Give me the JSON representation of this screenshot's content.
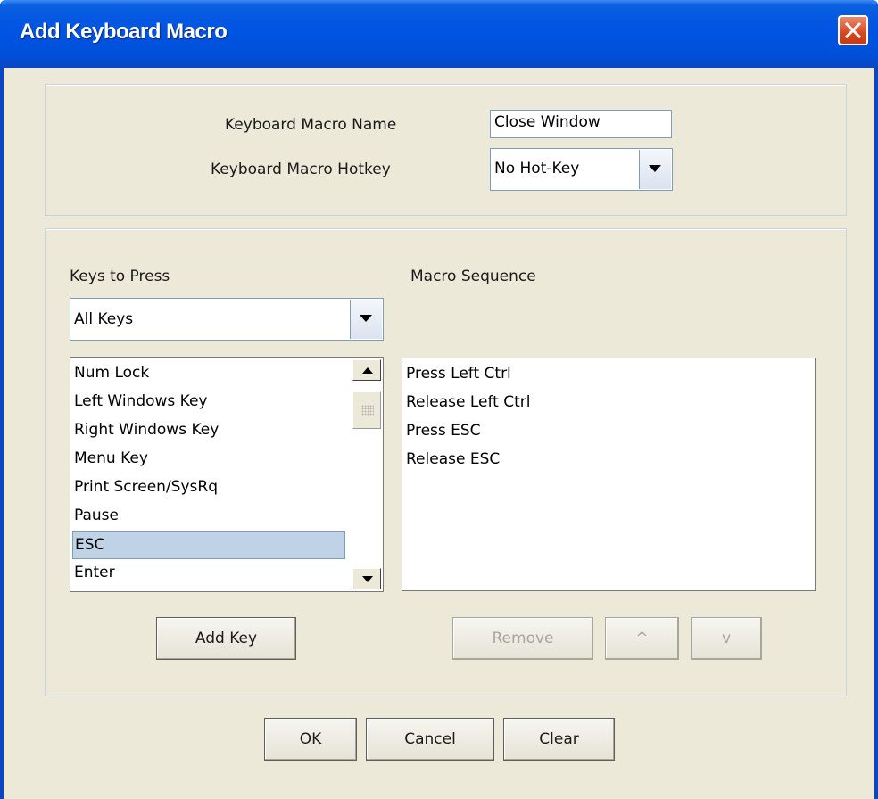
{
  "window": {
    "title": "Add Keyboard Macro",
    "close_glyph": "✕"
  },
  "macro": {
    "name_label": "Keyboard Macro Name",
    "name_value": "Close Window",
    "hotkey_label": "Keyboard Macro Hotkey",
    "hotkey_value": "No Hot-Key"
  },
  "keys": {
    "label": "Keys to Press",
    "filter_value": "All Keys",
    "items": [
      "Num Lock",
      "Left Windows Key",
      "Right Windows Key",
      "Menu Key",
      "Print Screen/SysRq",
      "Pause",
      "ESC",
      "Enter"
    ],
    "selected": "ESC"
  },
  "sequence": {
    "label": "Macro Sequence",
    "items": [
      "Press Left Ctrl",
      "Release Left Ctrl",
      "Press ESC",
      "Release ESC"
    ]
  },
  "buttons": {
    "add_key": "Add Key",
    "remove": "Remove",
    "up": "^",
    "down": "v",
    "ok": "OK",
    "cancel": "Cancel",
    "clear": "Clear"
  },
  "colors": {
    "titlebar": "#0054e3",
    "dialog_bg": "#ece9d8",
    "selection": "#bfd2e6",
    "close_button": "#d7471f"
  }
}
